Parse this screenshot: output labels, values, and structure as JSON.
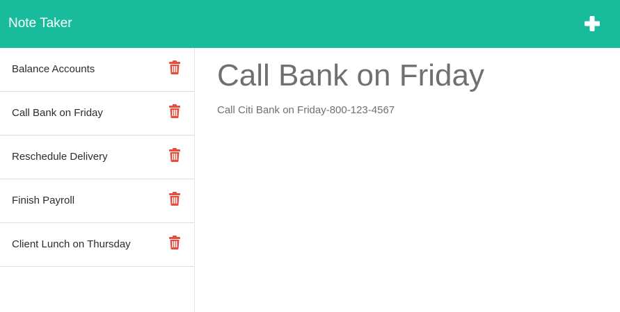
{
  "app": {
    "brand": "Note Taker",
    "accent_color": "#18bc9c",
    "add_icon": "plus-icon",
    "delete_icon": "trash-icon",
    "delete_color": "#e74c3c"
  },
  "notes": [
    {
      "title": "Balance Accounts"
    },
    {
      "title": "Call Bank on Friday"
    },
    {
      "title": "Reschedule Delivery"
    },
    {
      "title": "Finish Payroll"
    },
    {
      "title": "Client Lunch on Thursday"
    }
  ],
  "active_note": {
    "title": "Call Bank on Friday",
    "text": "Call Citi Bank on Friday-800-123-4567"
  }
}
